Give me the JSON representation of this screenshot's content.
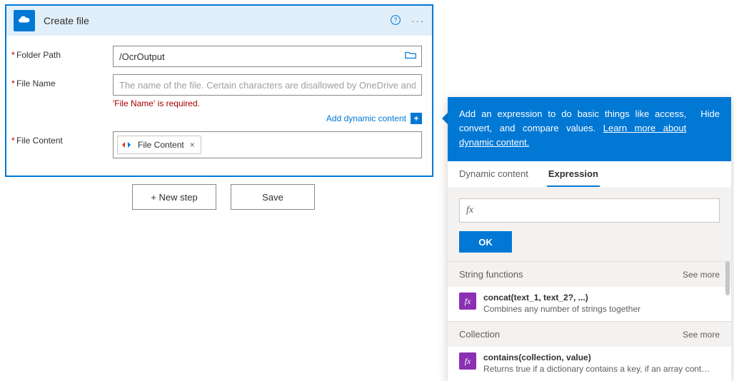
{
  "card": {
    "title": "Create file",
    "fields": {
      "folder_label": "Folder Path",
      "folder_value": "/OcrOutput",
      "filename_label": "File Name",
      "filename_placeholder": "The name of the file. Certain characters are disallowed by OneDrive and will be",
      "filename_error": "'File Name' is required.",
      "content_label": "File Content"
    },
    "dyn_link": "Add dynamic content",
    "token": {
      "label": "File Content",
      "close": "×"
    }
  },
  "buttons": {
    "new_step": "+ New step",
    "save": "Save"
  },
  "panel": {
    "head_pre": "Add an expression to do basic things like access, convert, and compare values. ",
    "head_link": "Learn more about dynamic content.",
    "hide": "Hide",
    "tabs": {
      "dynamic": "Dynamic content",
      "expression": "Expression"
    },
    "fx": "fx",
    "ok": "OK",
    "categories": [
      {
        "title": "String functions",
        "see_more": "See more",
        "fn": {
          "sig": "concat(text_1, text_2?, ...)",
          "desc": "Combines any number of strings together"
        }
      },
      {
        "title": "Collection",
        "see_more": "See more",
        "fn": {
          "sig": "contains(collection, value)",
          "desc": "Returns true if a dictionary contains a key, if an array cont…"
        }
      }
    ]
  },
  "icons": {
    "help": "?",
    "menu": "···",
    "plus": "+"
  }
}
